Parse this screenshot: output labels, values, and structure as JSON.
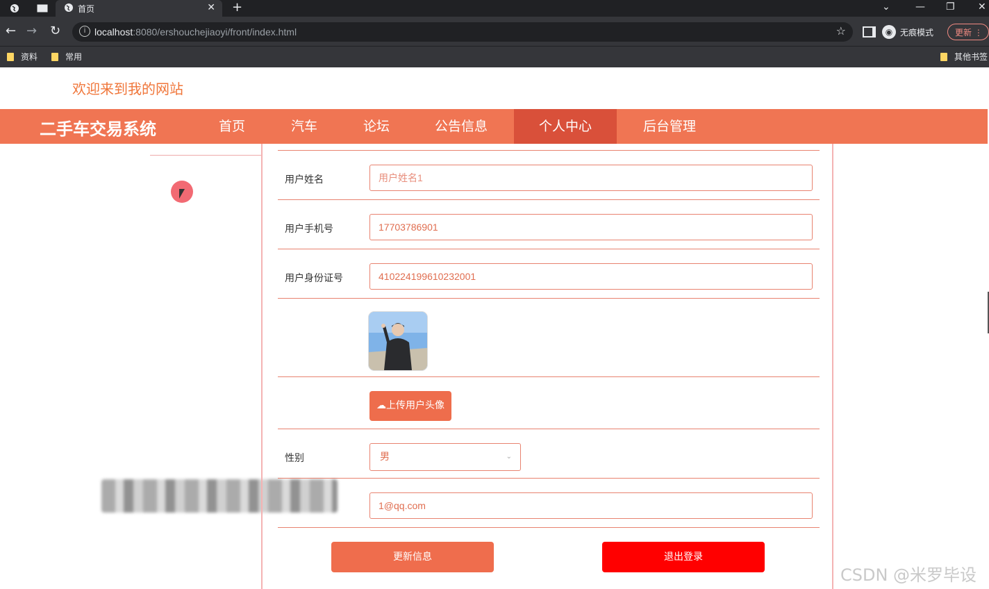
{
  "browser": {
    "tab_title": "首页",
    "url_host": "localhost",
    "url_rest": ":8080/ershouchejiaoyi/front/index.html",
    "incognito_label": "无痕模式",
    "update_label": "更新",
    "bookmarks": [
      "资料",
      "常用"
    ],
    "other_bookmarks": "其他书签"
  },
  "site": {
    "welcome": "欢迎来到我的网站",
    "brand": "二手车交易系统",
    "nav": [
      "首页",
      "汽车",
      "论坛",
      "公告信息",
      "个人中心",
      "后台管理"
    ],
    "active_nav": "个人中心",
    "accent": "#f07553"
  },
  "form": {
    "name_label": "用户姓名",
    "name_placeholder": "用户姓名1",
    "phone_label": "用户手机号",
    "phone_value": "17703786901",
    "id_label": "用户身份证号",
    "id_value": "410224199610232001",
    "upload_label": "上传用户头像",
    "gender_label": "性别",
    "gender_value": "男",
    "email_value": "1@qq.com",
    "update_button": "更新信息",
    "logout_button": "退出登录"
  },
  "watermark": "CSDN @米罗毕设"
}
